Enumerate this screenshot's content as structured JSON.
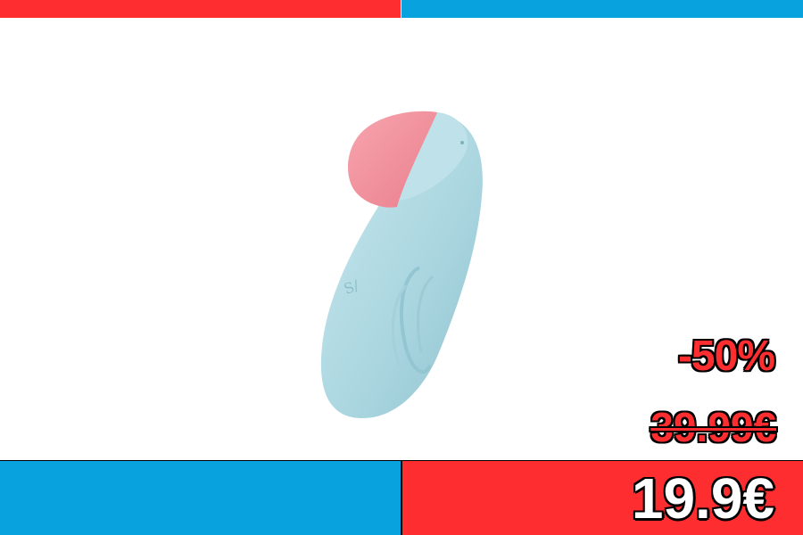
{
  "colors": {
    "red": "#fe2d2f",
    "blue": "#08a2de",
    "product_body": "#b5dce6",
    "product_tip": "#f2919d"
  },
  "product": {
    "icon": "product-image"
  },
  "pricing": {
    "discount": "-50%",
    "old_price": "39.99€",
    "new_price": "19.9€"
  }
}
